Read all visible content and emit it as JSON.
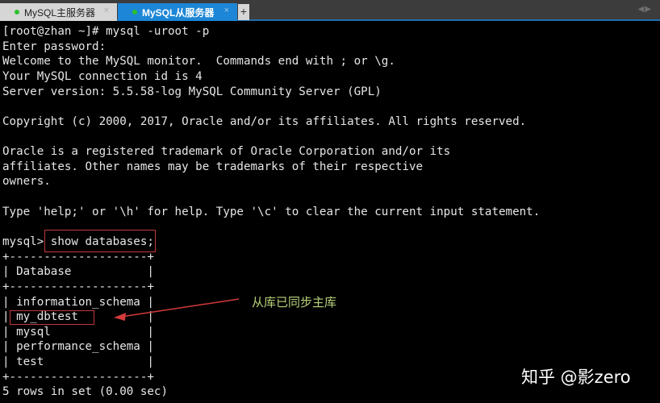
{
  "tabs": [
    {
      "label": "MySQL主服务器",
      "active": false,
      "status_color": "#2cc02c"
    },
    {
      "label": "MySQL从服务器",
      "active": true,
      "status_color": "#2cc02c"
    }
  ],
  "tab_close_glyph": "×",
  "add_tab_glyph": "+",
  "nav_arrows_glyph": "◀▶",
  "terminal": {
    "lines": [
      "[root@zhan ~]# mysql -uroot -p",
      "Enter password:",
      "Welcome to the MySQL monitor.  Commands end with ; or \\g.",
      "Your MySQL connection id is 4",
      "Server version: 5.5.58-log MySQL Community Server (GPL)",
      "",
      "Copyright (c) 2000, 2017, Oracle and/or its affiliates. All rights reserved.",
      "",
      "Oracle is a registered trademark of Oracle Corporation and/or its",
      "affiliates. Other names may be trademarks of their respective",
      "owners.",
      "",
      "Type 'help;' or '\\h' for help. Type '\\c' to clear the current input statement.",
      "",
      "mysql> show databases;",
      "+--------------------+",
      "| Database           |",
      "+--------------------+",
      "| information_schema |",
      "| my_dbtest          |",
      "| mysql              |",
      "| performance_schema |",
      "| test               |",
      "+--------------------+",
      "5 rows in set (0.00 sec)"
    ]
  },
  "annotation": {
    "text": "从库已同步主库",
    "color": "#b9d27a",
    "highlight_color": "#c0393b"
  },
  "watermark": "知乎 @影zero"
}
